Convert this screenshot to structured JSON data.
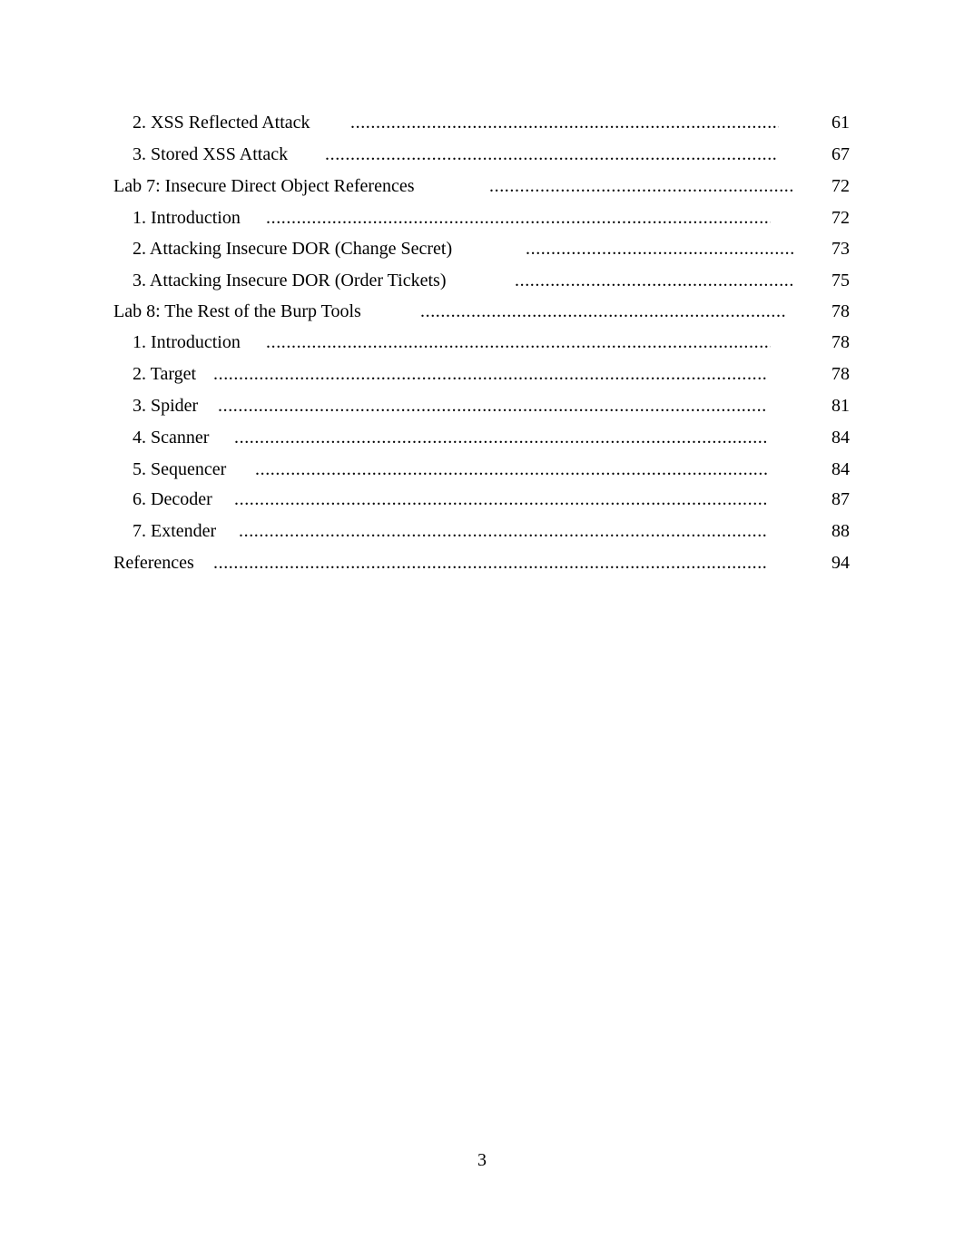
{
  "toc": {
    "entries": [
      {
        "title": "2. XSS Reflected Attack",
        "page": "61",
        "level": 1
      },
      {
        "title": "3. Stored XSS Attack",
        "page": "67",
        "level": 1
      },
      {
        "title": "Lab 7: Insecure Direct Object References",
        "page": "72",
        "level": 0
      },
      {
        "title": "1. Introduction",
        "page": "72",
        "level": 1
      },
      {
        "title": "2. Attacking Insecure DOR (Change Secret)",
        "page": "73",
        "level": 1
      },
      {
        "title": "3. Attacking Insecure DOR (Order Tickets)",
        "page": "75",
        "level": 1
      },
      {
        "title": "Lab 8: The Rest of the Burp Tools",
        "page": "78",
        "level": 0
      },
      {
        "title": "1. Introduction",
        "page": "78",
        "level": 1
      },
      {
        "title": "2. Target",
        "page": "78",
        "level": 1
      },
      {
        "title": "3. Spider",
        "page": "81",
        "level": 1
      },
      {
        "title": "4. Scanner",
        "page": "84",
        "level": 1
      },
      {
        "title": "5. Sequencer",
        "page": "84",
        "level": 1
      },
      {
        "title": "6. Decoder",
        "page": "87",
        "level": 1
      },
      {
        "title": "7. Extender",
        "page": "88",
        "level": 1
      },
      {
        "title": "References",
        "page": "94",
        "level": 0
      }
    ],
    "leader_char": "."
  },
  "footer": {
    "page_number": "3"
  }
}
